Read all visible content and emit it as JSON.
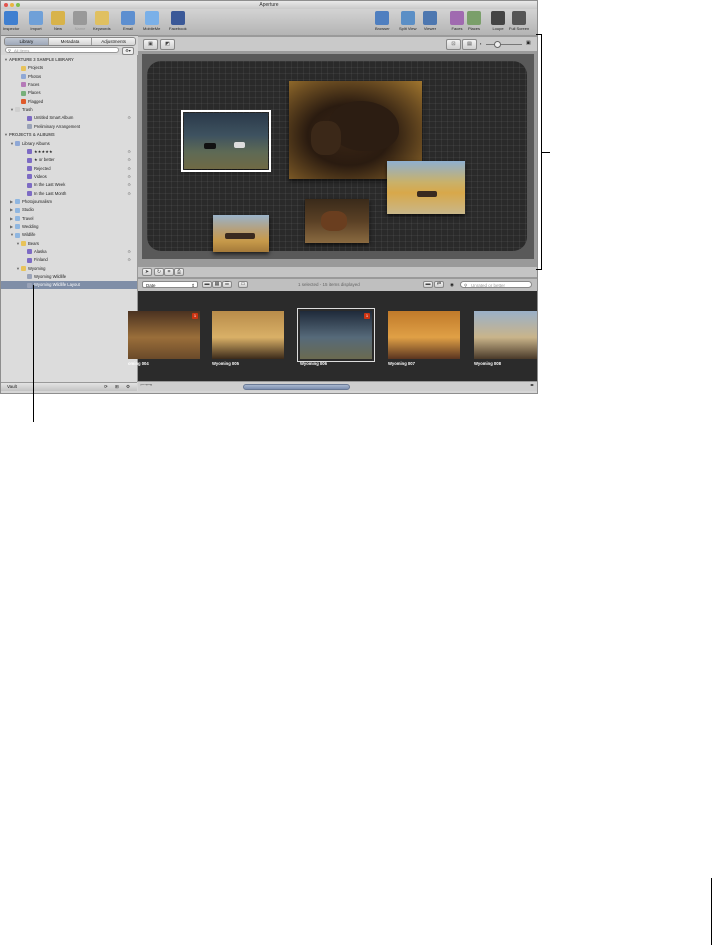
{
  "window": {
    "title": "Aperture"
  },
  "toolbar": {
    "left": [
      {
        "label": "Inspector",
        "icon": "info-icon"
      },
      {
        "label": "Import",
        "icon": "import-arrow-icon"
      },
      {
        "label": "New",
        "icon": "new-album-icon"
      },
      {
        "label": "Name",
        "icon": "name-face-icon",
        "disabled": true
      },
      {
        "label": "Keywords",
        "icon": "keywords-tag-icon"
      },
      {
        "label": "Email",
        "icon": "email-icon"
      },
      {
        "label": "MobileMe",
        "icon": "mobileme-cloud-icon"
      },
      {
        "label": "Facebook",
        "icon": "facebook-icon"
      }
    ],
    "right": [
      {
        "label": "Browser",
        "icon": "browser-grid-icon"
      },
      {
        "label": "Split View",
        "icon": "split-view-icon"
      },
      {
        "label": "Viewer",
        "icon": "viewer-icon"
      },
      {
        "label": "Faces",
        "icon": "faces-icon"
      },
      {
        "label": "Places",
        "icon": "places-icon"
      },
      {
        "label": "Loupe",
        "icon": "loupe-icon"
      },
      {
        "label": "Full Screen",
        "icon": "full-screen-icon"
      }
    ]
  },
  "inspector_tabs": [
    "Library",
    "Metadata",
    "Adjustments"
  ],
  "search": {
    "placeholder": "All Items"
  },
  "library": [
    {
      "label": "APERTURE 3 SAMPLE LIBRARY",
      "type": "header",
      "indent": 0,
      "tri": "▼"
    },
    {
      "label": "Projects",
      "indent": 2,
      "color": "#e8c35a"
    },
    {
      "label": "Photos",
      "indent": 2,
      "color": "#8fa8d6"
    },
    {
      "label": "Faces",
      "indent": 2,
      "color": "#b579b8"
    },
    {
      "label": "Places",
      "indent": 2,
      "color": "#78b07a"
    },
    {
      "label": "Flagged",
      "indent": 2,
      "color": "#e05a2b"
    },
    {
      "label": "Trash",
      "indent": 1,
      "color": "#cfcfcf",
      "tri": "▼"
    },
    {
      "label": "Untitled Smart Album",
      "indent": 3,
      "color": "#7d6bc4",
      "side": "⚙"
    },
    {
      "label": "Preliminary Arrangement",
      "indent": 3,
      "color": "#9aa3b8"
    },
    {
      "label": "PROJECTS & ALBUMS",
      "type": "header",
      "indent": 0,
      "tri": "▼"
    },
    {
      "label": "Library Albums",
      "indent": 1,
      "color": "#8fa8d6",
      "tri": "▼"
    },
    {
      "label": "★★★★★",
      "indent": 3,
      "color": "#7d6bc4",
      "side": "⚙"
    },
    {
      "label": "★ or better",
      "indent": 3,
      "color": "#7d6bc4",
      "side": "⚙"
    },
    {
      "label": "Rejected",
      "indent": 3,
      "color": "#7d6bc4",
      "side": "⚙"
    },
    {
      "label": "Videos",
      "indent": 3,
      "color": "#7d6bc4",
      "side": "⚙"
    },
    {
      "label": "In the Last Week",
      "indent": 3,
      "color": "#7d6bc4",
      "side": "⚙"
    },
    {
      "label": "In the Last Month",
      "indent": 3,
      "color": "#7d6bc4",
      "side": "⚙"
    },
    {
      "label": "Photojournalism",
      "indent": 1,
      "color": "#8fb6e0",
      "tri": "▶"
    },
    {
      "label": "Studio",
      "indent": 1,
      "color": "#8fb6e0",
      "tri": "▶"
    },
    {
      "label": "Travel",
      "indent": 1,
      "color": "#8fb6e0",
      "tri": "▶"
    },
    {
      "label": "Wedding",
      "indent": 1,
      "color": "#8fb6e0",
      "tri": "▶"
    },
    {
      "label": "Wildlife",
      "indent": 1,
      "color": "#8fb6e0",
      "tri": "▼"
    },
    {
      "label": "Bears",
      "indent": 2,
      "color": "#e8c35a",
      "tri": "▼"
    },
    {
      "label": "Alaska",
      "indent": 3,
      "color": "#7d6bc4",
      "side": "⚙"
    },
    {
      "label": "Finland",
      "indent": 3,
      "color": "#7d6bc4",
      "side": "⚙"
    },
    {
      "label": "Wyoming",
      "indent": 2,
      "color": "#e8c35a",
      "tri": "▼"
    },
    {
      "label": "Wyoming Wildlife",
      "indent": 3,
      "color": "#9aa3b8"
    },
    {
      "label": "Wyoming Wildlife Layout",
      "indent": 3,
      "color": "#9aa3b8",
      "selected": true
    }
  ],
  "sidebar_bottom": {
    "label": "Vault"
  },
  "light_table": {
    "status": "1 selected - 15 items displayed",
    "sort": "Date",
    "filter_placeholder": "Unrated or better"
  },
  "browser": {
    "thumbnails": [
      {
        "caption": "oming 004",
        "badge": "1",
        "colors": [
          "#4b3220",
          "#9a6e3a",
          "#6a4a2a"
        ]
      },
      {
        "caption": "Wyoming 005",
        "colors": [
          "#b88c4a",
          "#d9b067",
          "#3b2a1a"
        ]
      },
      {
        "caption": "Wyoming 006",
        "badge": "1",
        "selected": true,
        "colors": [
          "#1f2a3a",
          "#566a7a",
          "#6a6a50"
        ]
      },
      {
        "caption": "Wyoming 007",
        "colors": [
          "#c07a2a",
          "#e0a046",
          "#5a3520"
        ]
      },
      {
        "caption": "Wyoming 008",
        "colors": [
          "#9ab0c8",
          "#c9b48a",
          "#4a3a2a"
        ]
      }
    ]
  }
}
